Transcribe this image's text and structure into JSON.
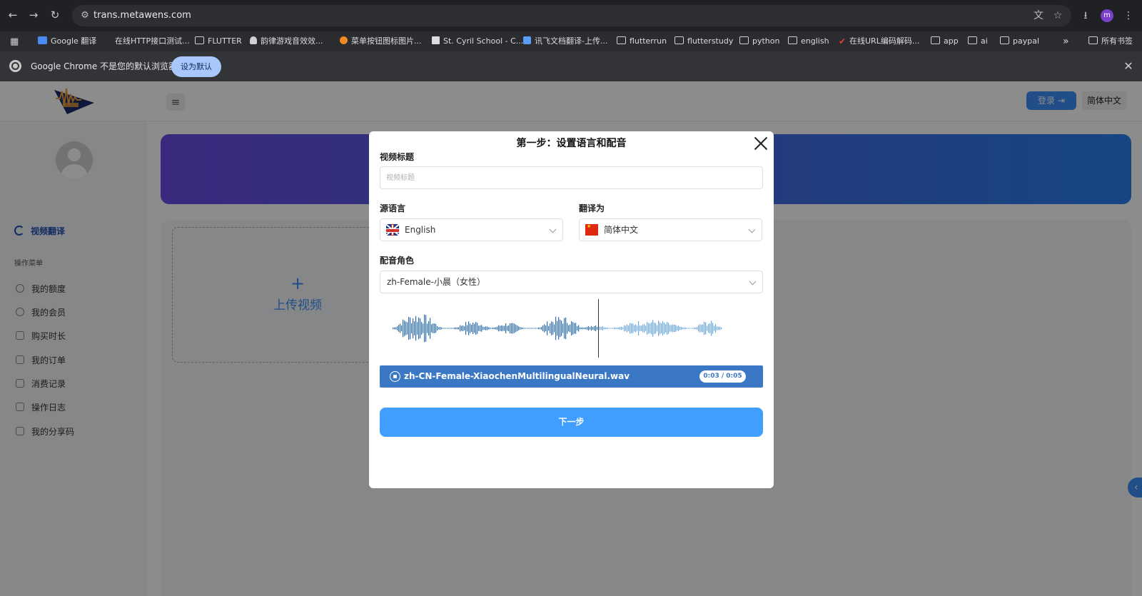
{
  "browser": {
    "url": "trans.metawens.com",
    "bookmarks": [
      {
        "label": "Google 翻译",
        "icon": "google-translate-icon"
      },
      {
        "label": "在线HTTP接口测试...",
        "icon": "site-icon"
      },
      {
        "label": "FLUTTER",
        "icon": "folder-icon"
      },
      {
        "label": "韵律游戏音效效...",
        "icon": "ghost-icon"
      },
      {
        "label": "菜单按钮图标图片...",
        "icon": "fox-icon"
      },
      {
        "label": "St. Cyril School - C...",
        "icon": "school-icon"
      },
      {
        "label": "讯飞文档翻译-上传...",
        "icon": "xunfei-icon"
      },
      {
        "label": "flutterrun",
        "icon": "folder-icon"
      },
      {
        "label": "flutterstudy",
        "icon": "folder-icon"
      },
      {
        "label": "python",
        "icon": "folder-icon"
      },
      {
        "label": "english",
        "icon": "folder-icon"
      },
      {
        "label": "在线URL编码解码...",
        "icon": "check-icon"
      },
      {
        "label": "app",
        "icon": "folder-icon"
      },
      {
        "label": "ai",
        "icon": "folder-icon"
      },
      {
        "label": "paypal",
        "icon": "folder-icon"
      }
    ],
    "overflow": "»",
    "all_bookmarks": "所有书签",
    "profile_initial": "m",
    "infobar": {
      "message": "Google Chrome 不是您的默认浏览器",
      "button": "设为默认"
    }
  },
  "app": {
    "header": {
      "login": "登录",
      "language": "简体中文"
    },
    "sidebar": {
      "active": "视频翻译",
      "section": "操作菜单",
      "items": [
        "我的额度",
        "我的会员",
        "购买时长",
        "我的订单",
        "消费记录",
        "操作日志",
        "我的分享码"
      ]
    },
    "upload": {
      "plus": "+",
      "label": "上传视频"
    }
  },
  "dialog": {
    "title": "第一步：设置语言和配音",
    "video_title_label": "视频标题",
    "video_title_placeholder": "视频标题",
    "source_language_label": "源语言",
    "source_language": "English",
    "target_language_label": "翻译为",
    "target_language": "简体中文",
    "voice_label": "配音角色",
    "voice": "zh-Female-小晨（女性）",
    "audio": {
      "filename": "zh-CN-Female-XiaochenMultilingualNeural.wav",
      "time": "0:03 / 0:05",
      "progress": 0.6
    },
    "next_button": "下一步"
  },
  "colors": {
    "accent": "#409eff",
    "audio_bar": "#3a78c6",
    "wave_played": "#2f6fae",
    "wave_unplayed": "#6aa8e8"
  }
}
